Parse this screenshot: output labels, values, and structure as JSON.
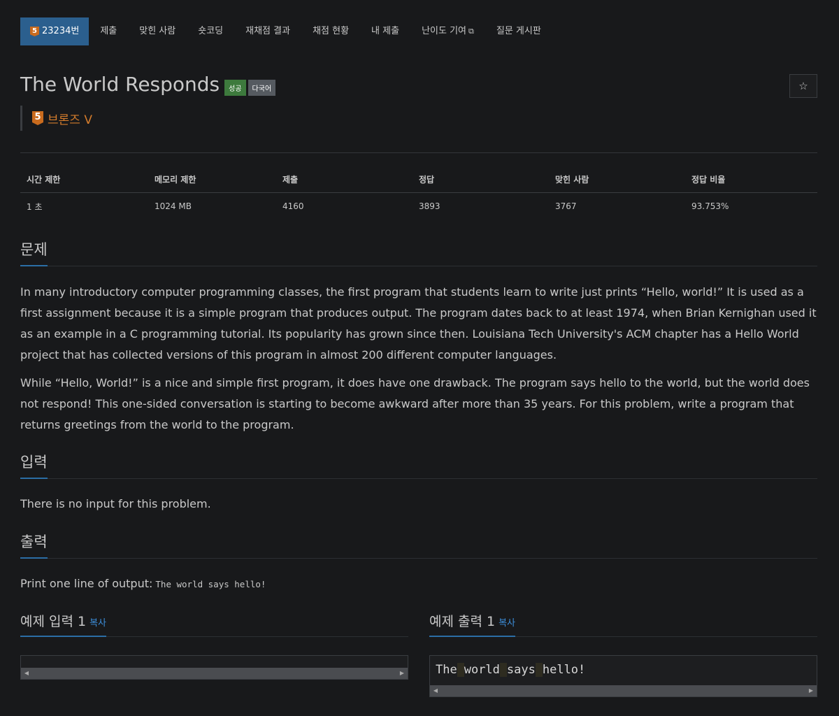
{
  "nav": {
    "problem_tier": "5",
    "problem_number": "23234번",
    "items": [
      "제출",
      "맞힌 사람",
      "숏코딩",
      "재채점 결과",
      "채점 현황",
      "내 제출",
      "난이도 기여",
      "질문 게시판"
    ]
  },
  "problem": {
    "title": "The World Responds",
    "labels": [
      "성공",
      "다국어"
    ],
    "tier_number": "5",
    "tier_text": "브론즈 V"
  },
  "info_table": {
    "headers": [
      "시간 제한",
      "메모리 제한",
      "제출",
      "정답",
      "맞힌 사람",
      "정답 비율"
    ],
    "values": [
      "1 초",
      "1024 MB",
      "4160",
      "3893",
      "3767",
      "93.753%"
    ]
  },
  "sections": {
    "description_title": "문제",
    "description_p1": "In many introductory computer programming classes, the first program that students learn to write just prints “Hello, world!” It is used as a first assignment because it is a simple program that produces output. The program dates back to at least 1974, when Brian Kernighan used it as an example in a C programming tutorial. Its popularity has grown since then. Louisiana Tech University's ACM chapter has a Hello World project that has collected versions of this program in almost 200 different computer languages.",
    "description_p2": "While “Hello, World!” is a nice and simple first program, it does have one drawback. The program says hello to the world, but the world does not respond! This one-sided conversation is starting to become awkward after more than 35 years. For this problem, write a program that returns greetings from the world to the program.",
    "input_title": "입력",
    "input_text": "There is no input for this problem.",
    "output_title": "출력",
    "output_text": "Print one line of output:",
    "output_code": "The world says hello!"
  },
  "samples": {
    "input_title": "예제 입력 1",
    "output_title": "예제 출력 1",
    "copy_label": "복사",
    "input_value": "",
    "output_words": [
      "The",
      "world",
      "says",
      "hello!"
    ]
  },
  "colors": {
    "background": "#18191b",
    "nav_active": "#2b5f8e",
    "tier_bronze": "#d47c2c",
    "success_label": "#3d7a3d",
    "link_blue": "#3c8dd9"
  },
  "icons": {
    "star": "☆",
    "external_link": "⧉",
    "scroll_left": "◀",
    "scroll_right": "▶"
  }
}
